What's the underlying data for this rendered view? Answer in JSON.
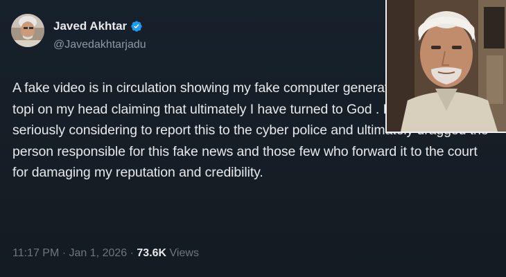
{
  "tweet": {
    "author_name": "Javed Akhtar",
    "handle": "@Javedakhtarjadu",
    "text": "A fake video is in circulation showing my fake computer generated picture with a topi on my head claiming that ultimately I have turned to God . It is rubbish . I am seriously considering to report this to the cyber police and ultimately dragged the person responsible for this fake news and those few who forward it to the court for damaging my reputation and credibility.",
    "time": "11:17 PM",
    "date": "Jan 1, 2026",
    "views_count": "73.6K",
    "views_label": "Views",
    "separator": "·"
  },
  "colors": {
    "background": "#15202b",
    "text_primary": "#e7e9ea",
    "text_secondary": "#71767b",
    "verified": "#1d9bf0"
  },
  "icons": {
    "verified": "verified-badge-icon",
    "avatar": "profile-photo",
    "inset": "portrait-photo"
  }
}
